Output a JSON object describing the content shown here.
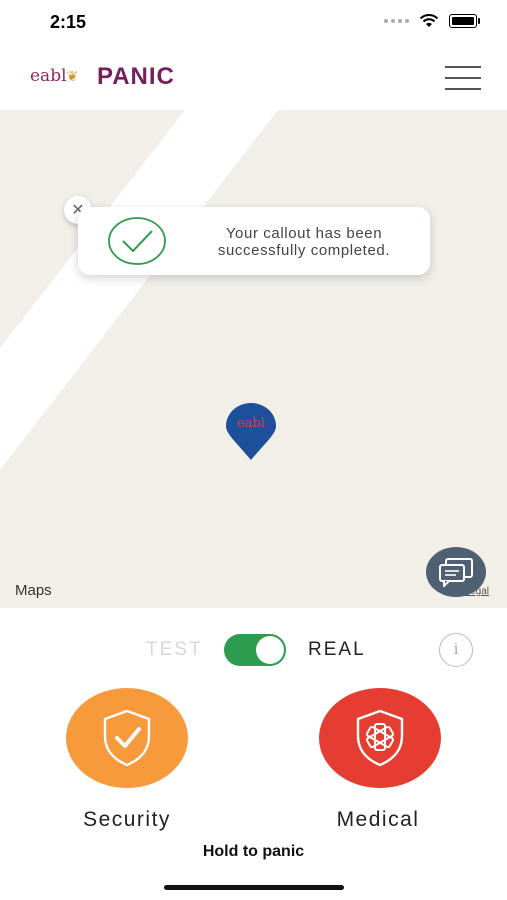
{
  "status_bar": {
    "time": "2:15"
  },
  "header": {
    "logo_text": "eabl",
    "title": "PANIC"
  },
  "map": {
    "attribution": "Maps",
    "legal": "Legal",
    "pin_label": "eabl",
    "background_color": "#f2efe9",
    "pin_color": "#1e4f9a"
  },
  "toast": {
    "message": "Your callout has been successfully completed.",
    "check_color": "#2e9c4e"
  },
  "mode_toggle": {
    "off_label": "TEST",
    "on_label": "REAL",
    "state": "REAL",
    "color": "#2e9c4e",
    "info_label": "i"
  },
  "panic_buttons": [
    {
      "label": "Security",
      "color": "#f79a3b",
      "icon": "shield-check-icon"
    },
    {
      "label": "Medical",
      "color": "#e63d33",
      "icon": "shield-medical-icon"
    }
  ],
  "hint": "Hold to panic",
  "accent_color": "#74205e"
}
